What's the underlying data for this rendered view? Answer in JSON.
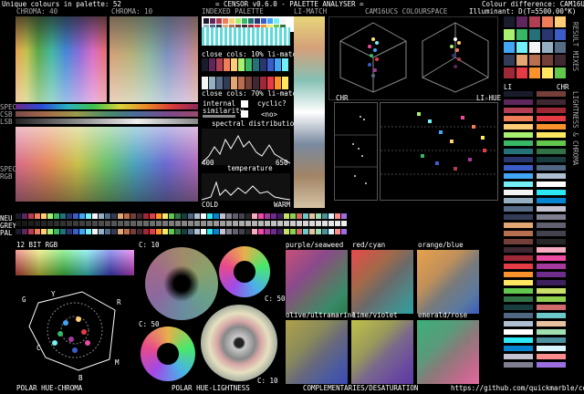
{
  "header": {
    "unique_colours": "Unique colours in palette: 52",
    "app_title": "= CENSOR v0.6.0 - PALETTE ANALYSER =",
    "diff_label": "Colour difference: CAM16UCS",
    "illuminant": "Illuminant: D(T=5500.00°K)"
  },
  "labels": {
    "chroma40": "CHROMA: 40",
    "chroma10": "CHROMA: 10",
    "indexed_palette": "INDEXED PALETTE",
    "li_match": "LI-MATCH",
    "cam16ucs": "CAM16UCS COLOURSPACE",
    "spec": "SPEC",
    "csb": "CSB",
    "lsb": "LSB",
    "spec_rgb": "SPEC RGB",
    "close_10": "close cols: 10% li-match",
    "close_70": "close cols: 70% li-match",
    "internal_similarity": "internal similarity",
    "cyclic": "cyclic?",
    "no": "<no>",
    "spectral": "spectral distribution",
    "wl_min": "400",
    "wl_max": "650",
    "temperature": "temperature",
    "cold": "COLD",
    "warm": "WARM",
    "chr": "CHR",
    "li_hue": "LI-HUE",
    "li": "LI",
    "chr2": "CHR",
    "neu": "NEU",
    "grey": "GREY",
    "pal": "PAL",
    "bit12": "12 BIT RGB",
    "c10a": "C: 10",
    "c50a": "C: 50",
    "c50b": "C: 50",
    "c10b": "C: 10",
    "purple_seaweed": "purple/seaweed",
    "red_cyan": "red/cyan",
    "orange_blue": "orange/blue",
    "olive_ultramarine": "olive/ultramarine",
    "lime_violet": "lime/violet",
    "emerald_rose": "emerald/rose",
    "polar_hue_chroma": "POLAR HUE-CHROMA",
    "polar_hue_lightness": "POLAR HUE-LIGHTNESS",
    "complementaries": "COMPLEMENTARIES/DESATURATION",
    "github": "https://github.com/quickmarble/censor",
    "side_mixes": "RESULT MIXES",
    "side_lightness": "LIGHTNESS & CHROMA",
    "g": "G",
    "y": "Y",
    "r": "R",
    "c": "C",
    "m": "M",
    "b": "B"
  },
  "palette": [
    "#1a1c2c",
    "#5d275d",
    "#b13e53",
    "#ef7d57",
    "#ffcd75",
    "#a7f070",
    "#38b764",
    "#257179",
    "#29366f",
    "#3b5dc9",
    "#41a6f6",
    "#73eff7",
    "#f4f4f4",
    "#94b0c2",
    "#566c86",
    "#333c57",
    "#e4a672",
    "#b86f50",
    "#743f39",
    "#3f2832",
    "#9e2835",
    "#e53b44",
    "#fb922b",
    "#ffe762",
    "#63c64d",
    "#327345",
    "#193d3f",
    "#4f6781",
    "#afbfd2",
    "#ffffff",
    "#2ce8f4",
    "#0484d1",
    "#c2c2d1",
    "#7e7e8f",
    "#606070",
    "#43434f",
    "#272728",
    "#f7acc3",
    "#ec4aa3",
    "#a5399e",
    "#6e2d8c",
    "#3d1f5e",
    "#c8e06a",
    "#8fd14f",
    "#d16b6b",
    "#6dc9c9",
    "#e8c1a0",
    "#a0e0b0",
    "#4c8f9e",
    "#d9f5ff",
    "#ff8c8c",
    "#9c6fe0"
  ]
}
